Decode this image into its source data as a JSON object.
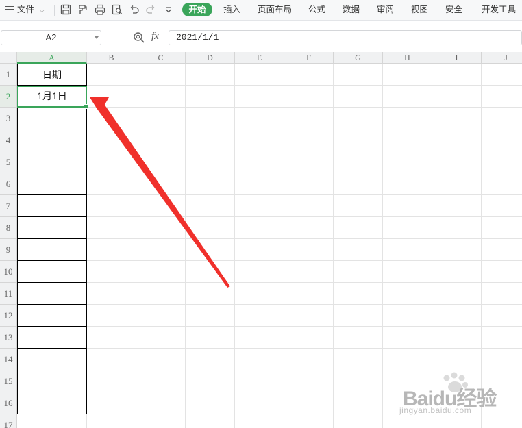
{
  "menu": {
    "file": "文件",
    "tabs": [
      "开始",
      "插入",
      "页面布局",
      "公式",
      "数据",
      "审阅",
      "视图",
      "安全",
      "开发工具"
    ],
    "active_tab": "开始",
    "accent_color": "#3aa55a"
  },
  "toolbar_icons": [
    "save-icon",
    "format-painter-icon",
    "print-icon",
    "print-preview-icon",
    "undo-icon",
    "redo-icon",
    "more-dropdown-icon"
  ],
  "formula_bar": {
    "name_box": "A2",
    "fx": "fx",
    "formula": "2021/1/1"
  },
  "sheet": {
    "columns": [
      "A",
      "B",
      "C",
      "D",
      "E",
      "F",
      "G",
      "H",
      "I",
      "J"
    ],
    "rows": [
      "1",
      "2",
      "3",
      "4",
      "5",
      "6",
      "7",
      "8",
      "9",
      "10",
      "11",
      "12",
      "13",
      "14",
      "15",
      "16",
      "17"
    ],
    "selected_cell": "A2",
    "cells": {
      "A1": "日期",
      "A2": "1月1日"
    }
  },
  "annotation": {
    "type": "arrow",
    "color": "#f0302b"
  },
  "watermark": {
    "text": "Baidu经验",
    "sub": "jingyan.baidu.com"
  }
}
